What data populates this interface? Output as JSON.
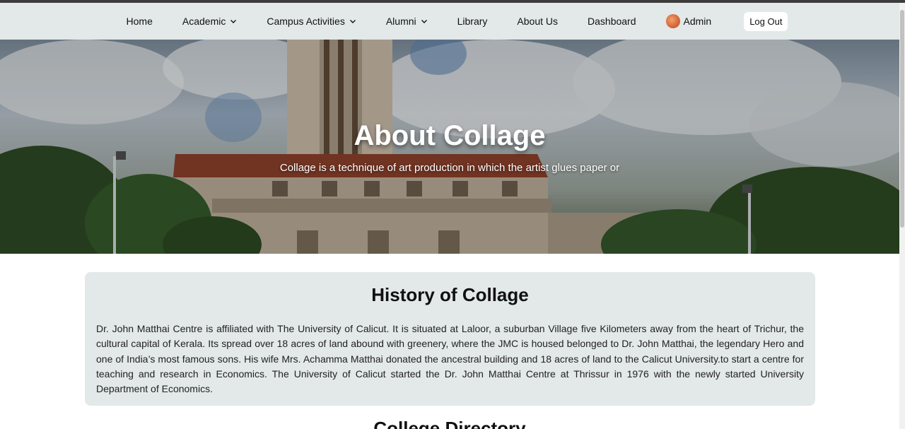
{
  "nav": {
    "items": [
      {
        "label": "Home",
        "dropdown": false
      },
      {
        "label": "Academic",
        "dropdown": true
      },
      {
        "label": "Campus Activities",
        "dropdown": true
      },
      {
        "label": "Alumni",
        "dropdown": true
      },
      {
        "label": "Library",
        "dropdown": false
      },
      {
        "label": "About Us",
        "dropdown": false
      },
      {
        "label": "Dashboard",
        "dropdown": false
      }
    ],
    "user_label": "Admin",
    "logout_label": "Log Out"
  },
  "hero": {
    "title": "About Collage",
    "subtitle": "Collage is a technique of art production in which the artist glues paper or"
  },
  "history": {
    "title": "History of Collage",
    "text": "Dr. John Matthai Centre is affiliated with The University of Calicut. It is situated at Laloor, a suburban Village five Kilometers away from the heart of Trichur, the cultural capital of Kerala. Its spread over 18 acres of land abound with greenery, where the JMC is housed belonged to Dr. John Matthai, the legendary Hero and one of India’s most famous sons. His wife Mrs. Achamma Matthai donated the ancestral building and 18 acres of land to the Calicut University.to start a centre for teaching and research in Economics. The University of Calicut started the Dr. John Matthai Centre at Thrissur in 1976 with the newly started University Department of Economics."
  },
  "directory": {
    "title": "College Directory"
  }
}
